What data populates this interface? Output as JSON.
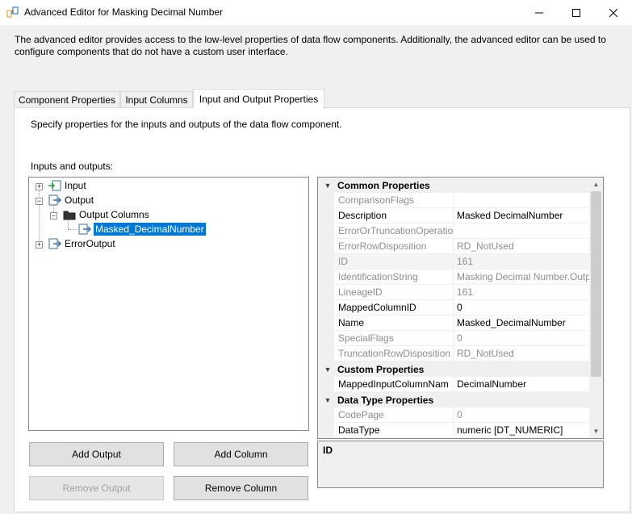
{
  "window": {
    "title": "Advanced Editor for Masking Decimal Number",
    "icon": "ssis-component-icon",
    "controls": [
      "minimize-icon",
      "maximize-icon",
      "close-icon"
    ]
  },
  "description": "The advanced editor provides access to the low-level properties of data flow components. Additionally, the advanced editor can be used to configure components that do not have a custom user interface.",
  "tabs": [
    {
      "label": "Component Properties",
      "active": false
    },
    {
      "label": "Input Columns",
      "active": false
    },
    {
      "label": "Input and Output Properties",
      "active": true
    }
  ],
  "panel": {
    "description": "Specify properties for the inputs and outputs of the data flow component.",
    "io_label": "Inputs and outputs:"
  },
  "tree": {
    "input": {
      "label": "Input",
      "expander": "+"
    },
    "output": {
      "label": "Output",
      "expander": "−"
    },
    "output_columns": {
      "label": "Output Columns",
      "expander": "−"
    },
    "selected_column": {
      "label": "Masked_DecimalNumber"
    },
    "error_output": {
      "label": "ErrorOutput",
      "expander": "+"
    }
  },
  "buttons": {
    "add_output": "Add Output",
    "add_column": "Add Column",
    "remove_output": "Remove Output",
    "remove_column": "Remove Column"
  },
  "properties": {
    "categories": {
      "common": "Common Properties",
      "custom": "Custom Properties",
      "data_type": "Data Type Properties"
    },
    "rows": {
      "comparison_flags": {
        "name": "ComparisonFlags",
        "value": ""
      },
      "description": {
        "name": "Description",
        "value": "Masked DecimalNumber"
      },
      "error_or_truncation": {
        "name": "ErrorOrTruncationOperatio",
        "value": ""
      },
      "error_row_disposition": {
        "name": "ErrorRowDisposition",
        "value": "RD_NotUsed"
      },
      "id": {
        "name": "ID",
        "value": "161"
      },
      "identification_string": {
        "name": "IdentificationString",
        "value": "Masking Decimal Number.Outp"
      },
      "lineage_id": {
        "name": "LineageID",
        "value": "161"
      },
      "mapped_column_id": {
        "name": "MappedColumnID",
        "value": "0"
      },
      "name": {
        "name": "Name",
        "value": "Masked_DecimalNumber"
      },
      "special_flags": {
        "name": "SpecialFlags",
        "value": "0"
      },
      "truncation_row_disposition": {
        "name": "TruncationRowDisposition",
        "value": "RD_NotUsed"
      },
      "mapped_input_column_name": {
        "name": "MappedInputColumnNam",
        "value": "DecimalNumber"
      },
      "code_page": {
        "name": "CodePage",
        "value": "0"
      },
      "data_type": {
        "name": "DataType",
        "value": "numeric [DT_NUMERIC]"
      }
    }
  },
  "help": {
    "title": "ID"
  },
  "colors": {
    "selection": "#0078d7",
    "background": "#f0f0f0",
    "disabled_text": "#a0a0a0"
  }
}
